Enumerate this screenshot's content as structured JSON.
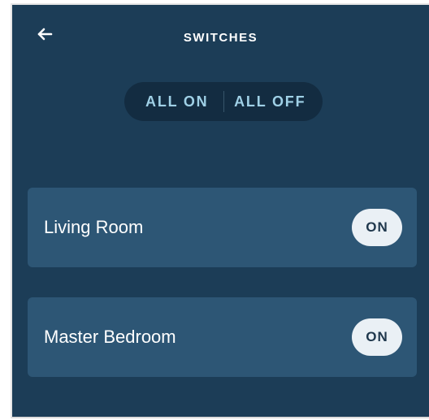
{
  "header": {
    "title": "SWITCHES",
    "back_icon": "arrow-left-icon"
  },
  "controls": {
    "all_on_label": "ALL ON",
    "all_off_label": "ALL OFF"
  },
  "switches": [
    {
      "name": "Living Room",
      "state_label": "ON"
    },
    {
      "name": "Master Bedroom",
      "state_label": "ON"
    }
  ],
  "colors": {
    "background": "#1c3d57",
    "card": "#2d5675",
    "segmented_bg": "#132c41",
    "segmented_text": "#9fd0e6",
    "toggle_bg": "#eaf0f5",
    "toggle_text": "#20384d"
  }
}
